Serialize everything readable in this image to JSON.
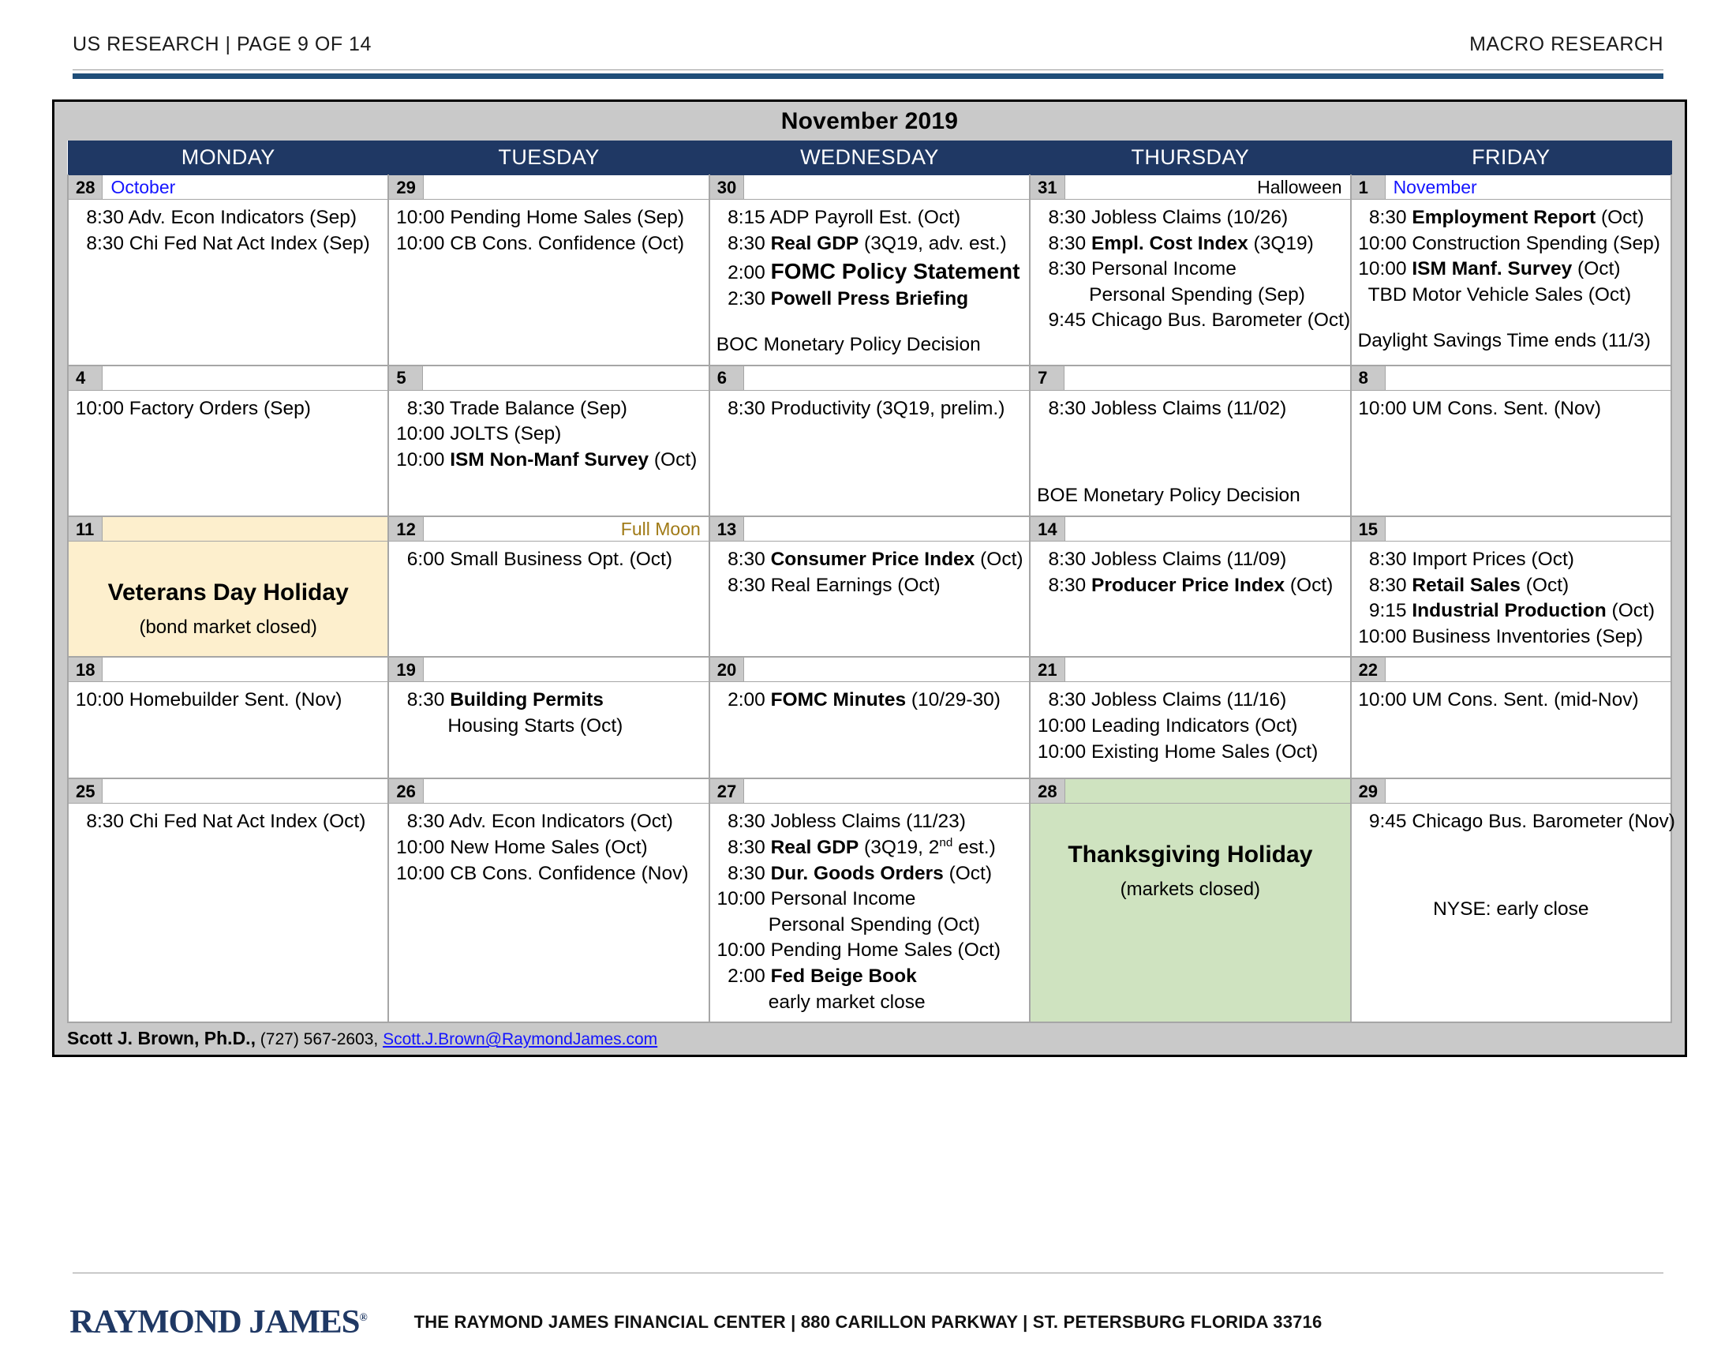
{
  "header": {
    "left": "US RESEARCH | PAGE 9 OF 14",
    "right": "MACRO RESEARCH"
  },
  "calendar": {
    "title": "November 2019",
    "weekday_headers": [
      "MONDAY",
      "TUESDAY",
      "WEDNESDAY",
      "THURSDAY",
      "FRIDAY"
    ],
    "weeks": [
      {
        "days": [
          {
            "num": "28",
            "note": "October",
            "note_style": "month",
            "note_align": "left",
            "events": [
              {
                "time": "8:30",
                "text": " Adv. Econ Indicators (Sep)"
              },
              {
                "time": "8:30",
                "text": " Chi Fed Nat Act Index (Sep)"
              }
            ]
          },
          {
            "num": "29",
            "note": "",
            "events": [
              {
                "time": "10:00",
                "text": " Pending Home Sales (Sep)"
              },
              {
                "time": "10:00",
                "text": " CB Cons. Confidence (Oct)"
              }
            ]
          },
          {
            "num": "30",
            "note": "",
            "events": [
              {
                "time": "8:15",
                "text": " ADP Payroll Est. (Oct)"
              },
              {
                "time": "8:30",
                "bold": "Real GDP",
                "text": " (3Q19, adv. est.)"
              },
              {
                "time": "2:00",
                "bold_big": "FOMC Policy Statement"
              },
              {
                "time": "2:30",
                "bold_big_sm": "Powell Press Briefing"
              },
              {
                "spacer": true
              },
              {
                "text": "BOC Monetary Policy Decision"
              }
            ]
          },
          {
            "num": "31",
            "note": "Halloween",
            "note_style": "plain",
            "note_align": "right",
            "events": [
              {
                "time": "8:30",
                "text": " Jobless Claims (10/26)"
              },
              {
                "time": "8:30",
                "bold": "Empl. Cost Index",
                "text": " (3Q19)"
              },
              {
                "time": "8:30",
                "text": " Personal Income"
              },
              {
                "indent": true,
                "text": "Personal Spending (Sep)"
              },
              {
                "time": "9:45",
                "text": " Chicago Bus. Barometer (Oct)"
              }
            ]
          },
          {
            "num": "1",
            "note": "November",
            "note_style": "month",
            "note_align": "left",
            "events": [
              {
                "time": "8:30",
                "bold": "Employment Report",
                "text": " (Oct)"
              },
              {
                "time": "10:00",
                "text": " Construction Spending (Sep)"
              },
              {
                "time": "10:00",
                "bold": "ISM Manf. Survey",
                "text": " (Oct)"
              },
              {
                "time": "TBD",
                "text": "  Motor Vehicle Sales (Oct)"
              },
              {
                "spacer": true
              },
              {
                "text": "Daylight Savings Time ends (11/3)"
              }
            ]
          }
        ]
      },
      {
        "days": [
          {
            "num": "4",
            "note": "",
            "events": [
              {
                "time": "10:00",
                "text": " Factory Orders (Sep)"
              }
            ]
          },
          {
            "num": "5",
            "note": "",
            "events": [
              {
                "time": "8:30",
                "text": " Trade Balance (Sep)"
              },
              {
                "time": "10:00",
                "text": " JOLTS (Sep)"
              },
              {
                "time": "10:00",
                "bold": "ISM Non-Manf Survey",
                "text": " (Oct)"
              }
            ]
          },
          {
            "num": "6",
            "note": "",
            "events": [
              {
                "time": "8:30",
                "text": " Productivity (3Q19, prelim.)"
              }
            ]
          },
          {
            "num": "7",
            "note": "",
            "events": [
              {
                "time": "8:30",
                "text": " Jobless Claims (11/02)"
              },
              {
                "spacer": true
              },
              {
                "spacer": true
              },
              {
                "spacer": true
              },
              {
                "text": "BOE Monetary Policy Decision"
              }
            ]
          },
          {
            "num": "8",
            "note": "",
            "events": [
              {
                "time": "10:00",
                "text": " UM Cons. Sent. (Nov)"
              }
            ]
          }
        ]
      },
      {
        "days": [
          {
            "num": "11",
            "note": "",
            "holiday": "veterans",
            "holiday_title": "Veterans Day Holiday",
            "holiday_sub": "(bond market closed)",
            "events": []
          },
          {
            "num": "12",
            "note": "Full Moon",
            "note_style": "moon",
            "note_align": "right",
            "events": [
              {
                "time": "6:00",
                "text": " Small Business Opt. (Oct)"
              }
            ]
          },
          {
            "num": "13",
            "note": "",
            "events": [
              {
                "time": "8:30",
                "bold": "Consumer Price Index",
                "text": " (Oct)"
              },
              {
                "time": "8:30",
                "text": " Real Earnings (Oct)"
              }
            ]
          },
          {
            "num": "14",
            "note": "",
            "events": [
              {
                "time": "8:30",
                "text": " Jobless Claims (11/09)"
              },
              {
                "time": "8:30",
                "bold": "Producer Price Index",
                "text": " (Oct)"
              }
            ]
          },
          {
            "num": "15",
            "note": "",
            "events": [
              {
                "time": "8:30",
                "text": " Import Prices (Oct)"
              },
              {
                "time": "8:30",
                "bold": "Retail Sales",
                "text": " (Oct)"
              },
              {
                "time": "9:15",
                "bold": "Industrial Production",
                "text": " (Oct)"
              },
              {
                "time": "10:00",
                "text": " Business Inventories (Sep)"
              }
            ]
          }
        ]
      },
      {
        "days": [
          {
            "num": "18",
            "note": "",
            "events": [
              {
                "time": "10:00",
                "text": " Homebuilder Sent. (Nov)"
              }
            ]
          },
          {
            "num": "19",
            "note": "",
            "events": [
              {
                "time": "8:30",
                "bold": "Building Permits"
              },
              {
                "indent": true,
                "text": "Housing Starts (Oct)"
              }
            ]
          },
          {
            "num": "20",
            "note": "",
            "events": [
              {
                "time": "2:00",
                "bold": "FOMC Minutes",
                "text": " (10/29-30)"
              }
            ]
          },
          {
            "num": "21",
            "note": "",
            "events": [
              {
                "time": "8:30",
                "text": " Jobless Claims (11/16)"
              },
              {
                "time": "10:00",
                "text": " Leading Indicators (Oct)"
              },
              {
                "time": "10:00",
                "text": " Existing Home Sales (Oct)"
              }
            ]
          },
          {
            "num": "22",
            "note": "",
            "events": [
              {
                "time": "10:00",
                "text": " UM Cons. Sent. (mid-Nov)"
              }
            ]
          }
        ]
      },
      {
        "days": [
          {
            "num": "25",
            "note": "",
            "events": [
              {
                "time": "8:30",
                "text": " Chi Fed Nat Act Index (Oct)"
              }
            ]
          },
          {
            "num": "26",
            "note": "",
            "events": [
              {
                "time": "8:30",
                "text": " Adv. Econ Indicators (Oct)"
              },
              {
                "time": "10:00",
                "text": " New Home Sales (Oct)"
              },
              {
                "time": "10:00",
                "text": " CB Cons. Confidence (Nov)"
              }
            ]
          },
          {
            "num": "27",
            "note": "",
            "events": [
              {
                "time": "8:30",
                "text": " Jobless Claims (11/23)"
              },
              {
                "time": "8:30",
                "bold": "Real GDP",
                "text": " (3Q19, 2",
                "sup": "nd",
                "text_after": " est.)"
              },
              {
                "time": "8:30",
                "bold": "Dur. Goods Orders",
                "text": " (Oct)"
              },
              {
                "time": "10:00",
                "text": " Personal Income"
              },
              {
                "indent": true,
                "text": "Personal Spending (Oct)"
              },
              {
                "time": "10:00",
                "text": " Pending Home Sales (Oct)"
              },
              {
                "time": "2:00",
                "bold": "Fed Beige Book"
              },
              {
                "indent": true,
                "text": "early market close"
              }
            ]
          },
          {
            "num": "28",
            "note": "",
            "holiday": "thanksgiving",
            "holiday_title": "Thanksgiving Holiday",
            "holiday_sub": "(markets closed)",
            "events": []
          },
          {
            "num": "29",
            "note": "",
            "events": [
              {
                "time": "9:45",
                "text": " Chicago Bus. Barometer (Nov)"
              },
              {
                "spacer": true
              },
              {
                "spacer": true
              },
              {
                "spacer": true
              },
              {
                "center": true,
                "text": "NYSE: early close"
              }
            ]
          }
        ]
      }
    ],
    "byline": {
      "name": "Scott J. Brown, Ph.D.,",
      "phone": " (727) 567-2603, ",
      "email": "Scott.J.Brown@RaymondJames.com"
    }
  },
  "footer": {
    "logo": "RAYMOND JAMES",
    "address": "THE RAYMOND JAMES FINANCIAL CENTER | 880 CARILLON PARKWAY | ST. PETERSBURG FLORIDA 33716"
  }
}
